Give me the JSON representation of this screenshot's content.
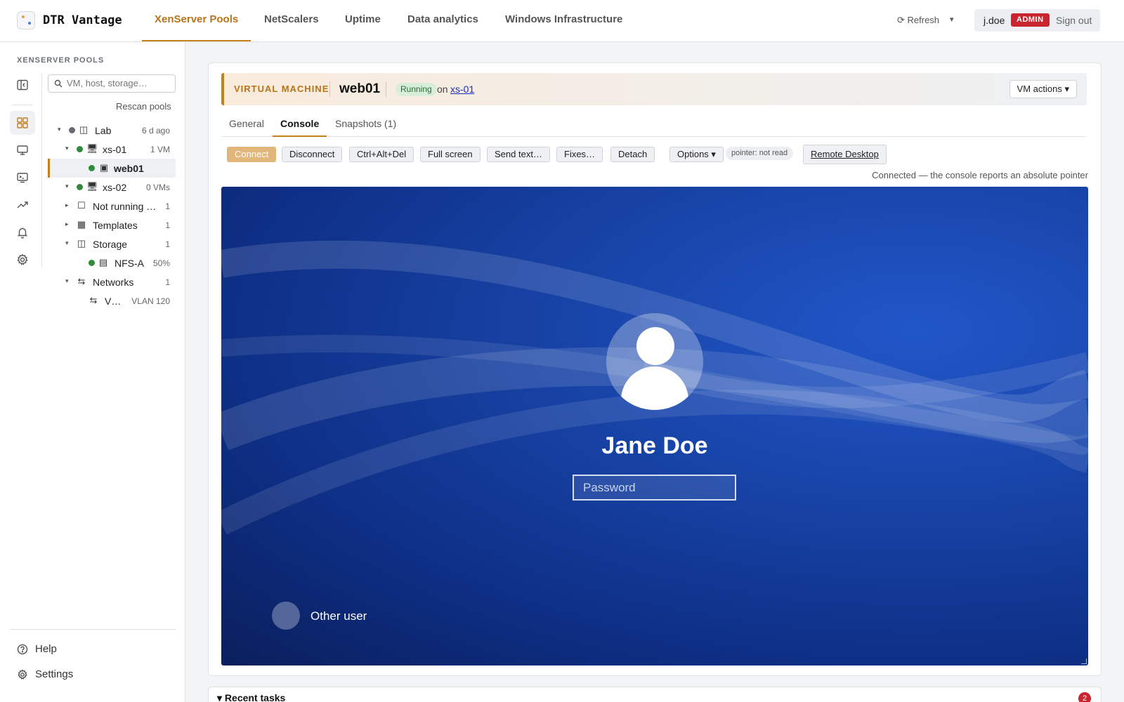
{
  "app": {
    "brand": "DTR Vantage"
  },
  "nav": {
    "tabs": [
      {
        "label": "XenServer Pools",
        "active": true
      },
      {
        "label": "NetScalers"
      },
      {
        "label": "Uptime"
      },
      {
        "label": "Data analytics"
      },
      {
        "label": "Windows Infrastructure"
      }
    ],
    "refresh_label": "⟳ Refresh",
    "refresh_caret": "▾",
    "user": "j.doe",
    "role_badge": "ADMIN",
    "signout": "Sign out"
  },
  "sidebar": {
    "title": "XENSERVER POOLS",
    "search_placeholder": "VM, host, storage…",
    "rescan": "Rescan pools",
    "tree": [
      {
        "label": "Lab",
        "meta": "6 d ago",
        "caret": "▾",
        "status": "gray",
        "icon": "pool-icon"
      },
      {
        "label": "xs-01",
        "meta": "1 VM",
        "caret": "▾",
        "status": "green",
        "icon": "host-icon"
      },
      {
        "label": "web01",
        "meta": "",
        "status": "green",
        "icon": "vm-icon",
        "selected": true
      },
      {
        "label": "xs-02",
        "meta": "0 VMs",
        "caret": "▾",
        "status": "green",
        "icon": "host-icon"
      },
      {
        "label": "Not running …",
        "meta": "1",
        "caret": "▸",
        "icon": "vm-stopped-icon"
      },
      {
        "label": "Templates",
        "meta": "1",
        "caret": "▸",
        "icon": "template-icon"
      },
      {
        "label": "Storage",
        "meta": "1",
        "caret": "▾",
        "icon": "storage-icon"
      },
      {
        "label": "NFS-A",
        "meta": "50%",
        "status": "green",
        "icon": "sr-icon"
      },
      {
        "label": "Networks",
        "meta": "1",
        "caret": "▾",
        "icon": "network-icon"
      },
      {
        "label": "V…",
        "meta": "VLAN 120",
        "icon": "network-icon"
      }
    ],
    "help": "Help",
    "settings": "Settings"
  },
  "vm": {
    "kicker": "VIRTUAL MACHINE",
    "name": "web01",
    "state": "Running",
    "on_label": "on",
    "host": "xs-01",
    "actions": "VM actions ▾"
  },
  "tabs": [
    {
      "label": "General"
    },
    {
      "label": "Console",
      "active": true
    },
    {
      "label": "Snapshots (1)"
    }
  ],
  "console_toolbar": {
    "connect": "Connect",
    "disconnect": "Disconnect",
    "ctrl_alt_del": "Ctrl+Alt+Del",
    "fullscreen": "Full screen",
    "send_text": "Send text…",
    "fixes": "Fixes…",
    "detach": "Detach",
    "options": "Options ▾",
    "pointer": "pointer: not read",
    "remote_desktop": "Remote Desktop",
    "status": "Connected — the console reports an absolute pointer"
  },
  "console_screen": {
    "user_name": "Jane Doe",
    "password_placeholder": "Password",
    "other_user": "Other user"
  },
  "recent_tasks": {
    "label": "▾ Recent tasks",
    "count": "2"
  },
  "colors": {
    "accent": "#c47f1f",
    "admin": "#c8252f",
    "ok": "#2e8b3a"
  }
}
